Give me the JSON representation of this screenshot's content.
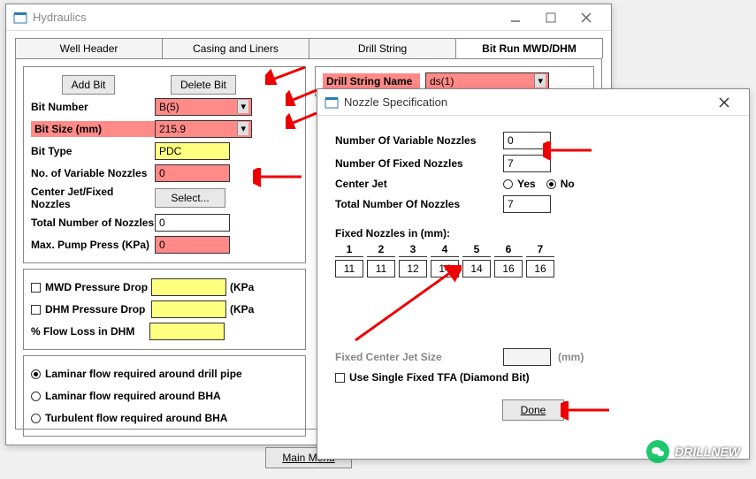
{
  "mainWindow": {
    "title": "Hydraulics",
    "tabs": [
      "Well Header",
      "Casing and Liners",
      "Drill String",
      "Bit Run MWD/DHM"
    ],
    "activeTab": 3,
    "buttons": {
      "addBit": "Add Bit",
      "deleteBit": "Delete Bit",
      "select": "Select...",
      "mainMenu": "Main Menu"
    },
    "drillString": {
      "label": "Drill String Name",
      "value": "ds(1)"
    },
    "bit": {
      "numberLabel": "Bit Number",
      "numberValue": "B(5)",
      "sizeLabel": "Bit Size (mm)",
      "sizeValue": "215.9",
      "typeLabel": "Bit Type",
      "typeValue": "PDC",
      "varNozLabel": "No. of Variable Nozzles",
      "varNozValue": "0",
      "centerLabel": "Center Jet/Fixed Nozzles",
      "totalNozLabel": "Total Number of Nozzles",
      "totalNozValue": "0",
      "maxPumpLabel": "Max. Pump Press (KPa)",
      "maxPumpValue": "0"
    },
    "mwd": {
      "mwdLabel": "MWD Pressure Drop",
      "mwdUnit": "(KPa",
      "dhmLabel": "DHM Pressure Drop",
      "dhmUnit": "(KPa",
      "flowLabel": "% Flow Loss in DHM"
    },
    "flow": {
      "opt1": "Laminar flow required around drill pipe",
      "opt2": "Laminar flow required around BHA",
      "opt3": "Turbulent flow required around BHA",
      "selected": 0
    }
  },
  "nozzleDialog": {
    "title": "Nozzle Specification",
    "varLabel": "Number Of Variable Nozzles",
    "varValue": "0",
    "fixedLabel": "Number Of Fixed Nozzles",
    "fixedValue": "7",
    "centerLabel": "Center Jet",
    "yes": "Yes",
    "no": "No",
    "centerValue": "no",
    "totalLabel": "Total Number Of Nozzles",
    "totalValue": "7",
    "fixedInLabel": "Fixed Nozzles in (mm):",
    "headers": [
      "1",
      "2",
      "3",
      "4",
      "5",
      "6",
      "7"
    ],
    "values": [
      "11",
      "11",
      "12",
      "14",
      "14",
      "16",
      "16"
    ],
    "centerSizeLabel": "Fixed Center Jet Size",
    "centerSizeUnit": "(mm)",
    "tfaLabel": "Use Single Fixed TFA (Diamond Bit)",
    "done": "Done"
  },
  "watermark": "DRILLNEW"
}
